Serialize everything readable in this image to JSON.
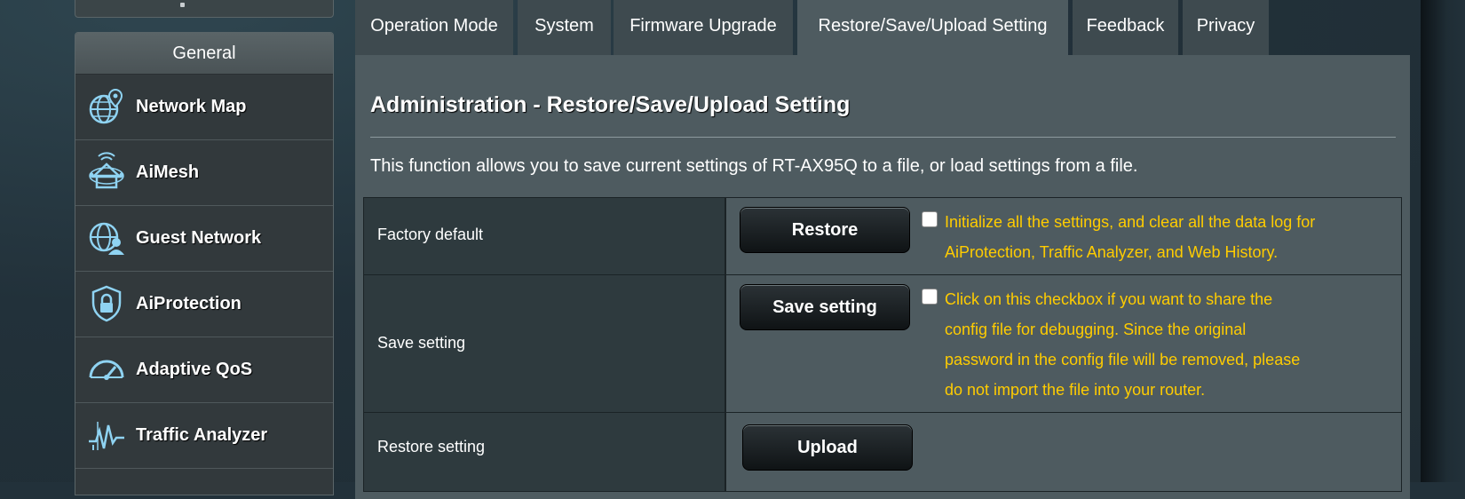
{
  "sidebar": {
    "header": "General",
    "items": [
      {
        "label": "Network Map",
        "icon": "globe-pin-icon"
      },
      {
        "label": "AiMesh",
        "icon": "aimesh-icon"
      },
      {
        "label": "Guest Network",
        "icon": "guest-network-icon"
      },
      {
        "label": "AiProtection",
        "icon": "shield-lock-icon"
      },
      {
        "label": "Adaptive QoS",
        "icon": "speedometer-icon"
      },
      {
        "label": "Traffic Analyzer",
        "icon": "traffic-analyzer-icon"
      }
    ]
  },
  "tabs": [
    {
      "label": "Operation Mode"
    },
    {
      "label": "System"
    },
    {
      "label": "Firmware Upgrade"
    },
    {
      "label": "Restore/Save/Upload Setting"
    },
    {
      "label": "Feedback"
    },
    {
      "label": "Privacy"
    }
  ],
  "active_tab": "Restore/Save/Upload Setting",
  "page": {
    "title": "Administration - Restore/Save/Upload Setting",
    "description": "This function allows you to save current settings of RT-AX95Q to a file, or load settings from a file."
  },
  "rows": {
    "factory": {
      "label": "Factory default",
      "button": "Restore",
      "note_line1": "Initialize all the settings, and clear all the data log for",
      "note_line2": "AiProtection, Traffic Analyzer, and Web History."
    },
    "save": {
      "label": "Save setting",
      "button": "Save setting",
      "note_line1": "Click on this checkbox if you want to share the",
      "note_line2": "config file for debugging. Since the original",
      "note_line3": "password in the config file will be removed, please",
      "note_line4": "do not import the file into your router."
    },
    "restore": {
      "label": "Restore setting",
      "button": "Upload"
    }
  },
  "colors": {
    "accent_note": "#ffcc00",
    "panel": "#4e5b60",
    "background": "#22313a"
  }
}
